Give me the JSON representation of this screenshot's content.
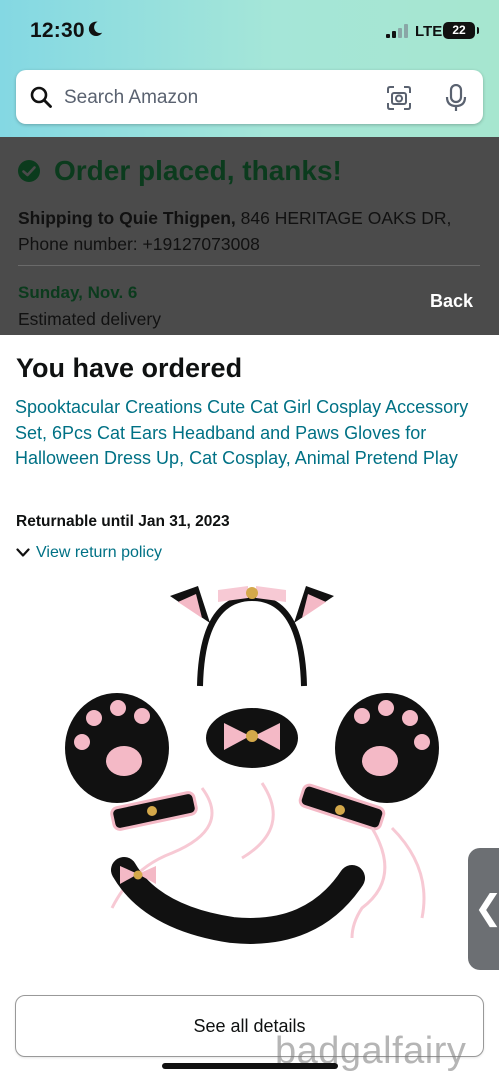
{
  "status_bar": {
    "time": "12:30",
    "network": "LTE",
    "battery": "22"
  },
  "search": {
    "placeholder": "Search Amazon"
  },
  "confirmation": {
    "title": "Order placed, thanks!",
    "ship_label": "Shipping to Quie Thigpen,",
    "ship_address": " 846 HERITAGE OAKS DR,",
    "phone": "Phone number: +19127073008",
    "delivery_date": "Sunday, Nov. 6",
    "delivery_label": "Estimated delivery",
    "back_label": "Back"
  },
  "order": {
    "heading": "You have ordered",
    "product_title": "Spooktacular Creations Cute Cat Girl Cosplay Accessory Set, 6Pcs Cat Ears Headband and Paws Gloves for Halloween Dress Up, Cat Cosplay, Animal Pretend Play",
    "returnable": "Returnable until Jan 31, 2023",
    "return_policy": "View return policy",
    "details_button": "See all details"
  },
  "side_tab_glyph": "❮",
  "watermark": "badgalfairy",
  "colors": {
    "link": "#007185",
    "header_start": "#84d8e3",
    "header_end": "#a6e6cf",
    "overlay": "#4b4b4b",
    "success": "#0b3b1d"
  }
}
